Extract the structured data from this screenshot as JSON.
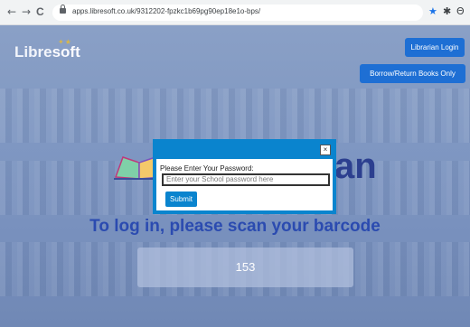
{
  "browser": {
    "back": "←",
    "forward": "→",
    "reload": "C",
    "url": "apps.libresoft.co.uk/9312202-fpzkc1b69pg90ep18e1o-bps/",
    "star": "★",
    "extension": "✱",
    "profile": "Θ"
  },
  "site": {
    "logo_main": "Libre",
    "logo_soft": "soft",
    "login_button": "Librarian Login",
    "borrow_button": "Borrow/Return Books Only",
    "big_word": "an",
    "scan_prompt": "To log in, please scan your barcode",
    "barcode_value": "153"
  },
  "modal": {
    "close": "×",
    "label": "Please Enter Your Password:",
    "placeholder": "Enter your School password here",
    "submit": "Submit"
  },
  "colors": {
    "accent": "#0a84ce",
    "button_blue": "#1e6fd4",
    "heading_blue": "#2b4bb0"
  }
}
